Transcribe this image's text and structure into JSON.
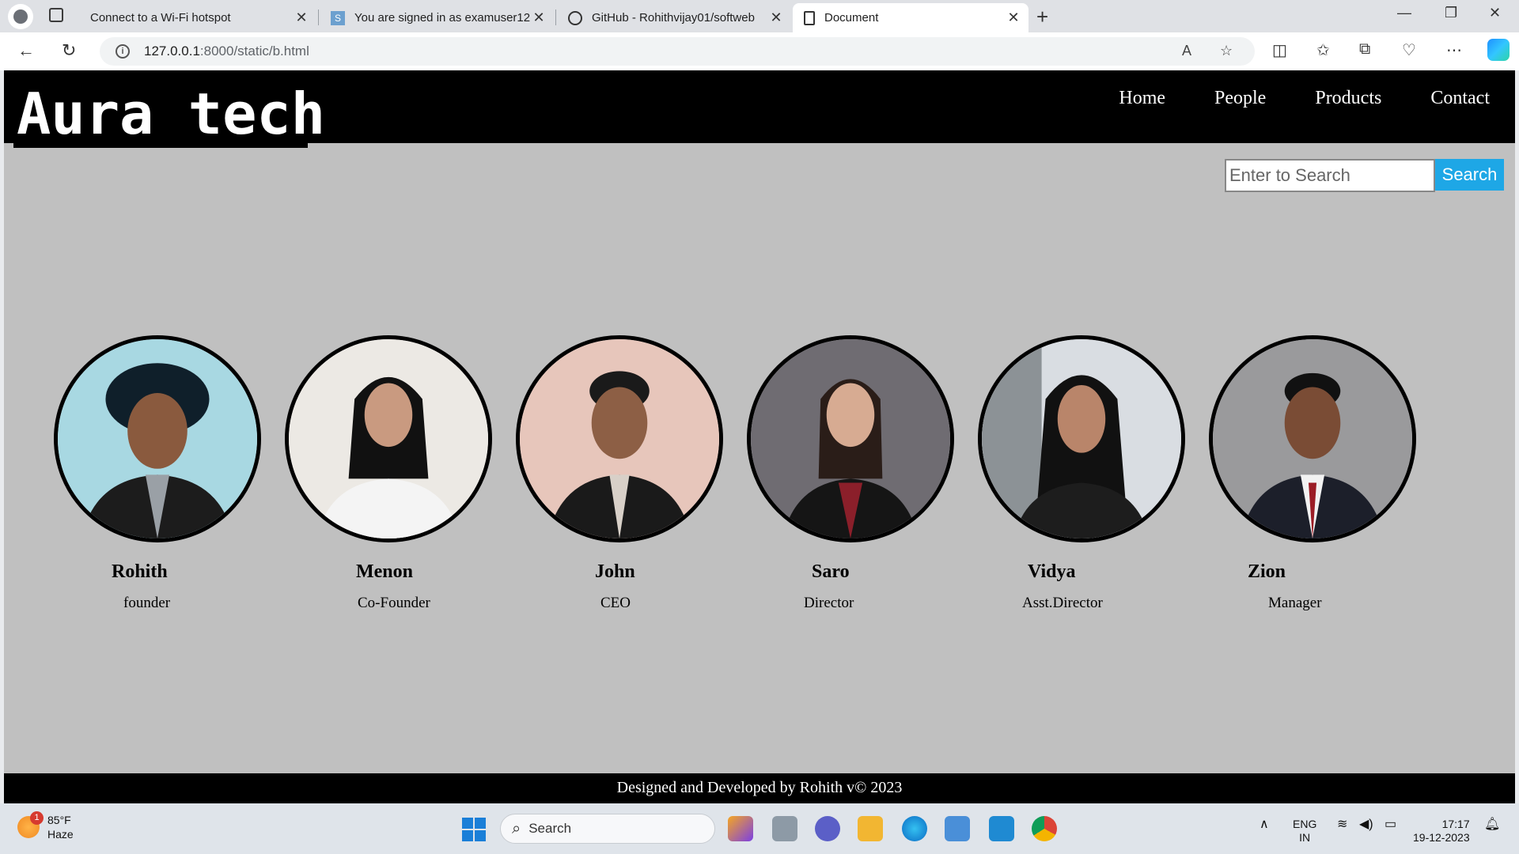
{
  "browser": {
    "tabs": [
      {
        "title": "Connect to a Wi-Fi hotspot",
        "active": false
      },
      {
        "title": "You are signed in as examuser12",
        "active": false
      },
      {
        "title": "GitHub - Rohithvijay01/softweb",
        "active": false
      },
      {
        "title": "Document",
        "active": true
      }
    ],
    "url_host": "127.0.0.1",
    "url_path": ":8000/static/b.html"
  },
  "site": {
    "brand": "Aura tech",
    "menu": [
      "Home",
      "People",
      "Products",
      "Contact"
    ],
    "search": {
      "placeholder": "Enter to Search",
      "button": "Search",
      "button_color": "#1ea7e6"
    },
    "people": [
      {
        "name": "Rohith",
        "role": "founder",
        "bg": "#a8d8e2"
      },
      {
        "name": "Menon",
        "role": "Co-Founder",
        "bg": "#ece9e4"
      },
      {
        "name": "John",
        "role": "CEO",
        "bg": "#e7c6bb"
      },
      {
        "name": "Saro",
        "role": "Director",
        "bg": "#6f6c72"
      },
      {
        "name": "Vidya",
        "role": "Asst.Director",
        "bg": "#d9dde2"
      },
      {
        "name": "Zion",
        "role": "Manager",
        "bg": "#9a9a9c"
      }
    ],
    "footer": "Designed and Developed by Rohith v© 2023"
  },
  "taskbar": {
    "weather_temp": "85°F",
    "weather_desc": "Haze",
    "weather_badge": "1",
    "search_label": "Search",
    "lang_top": "ENG",
    "lang_bottom": "IN",
    "time": "17:17",
    "date": "19-12-2023"
  }
}
